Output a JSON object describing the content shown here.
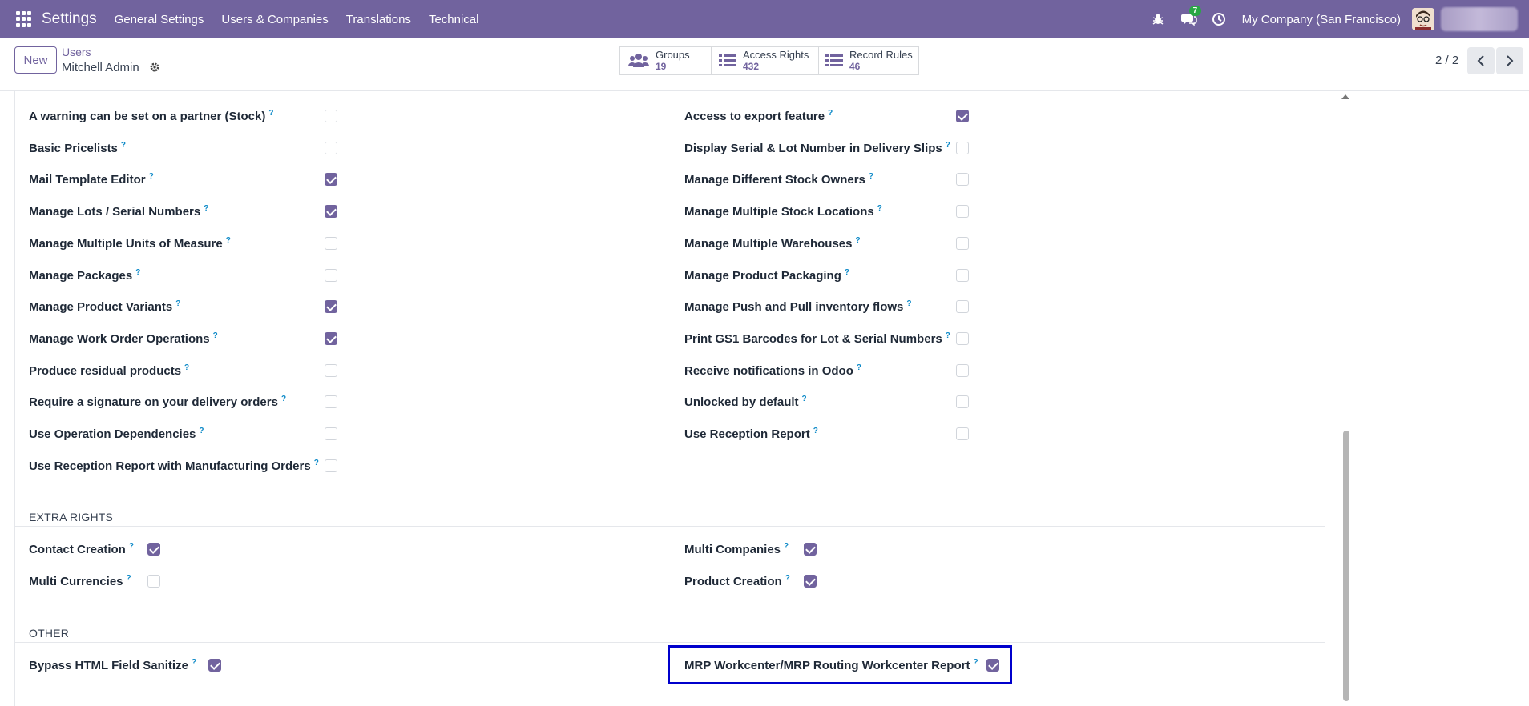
{
  "topbar": {
    "app_name": "Settings",
    "menus": [
      "General Settings",
      "Users & Companies",
      "Translations",
      "Technical"
    ],
    "chat_count": "7",
    "company": "My Company (San Francisco)"
  },
  "control": {
    "new_label": "New",
    "breadcrumb_parent": "Users",
    "breadcrumb_current": "Mitchell Admin",
    "groups_label": "Groups",
    "groups_count": "19",
    "access_label": "Access Rights",
    "access_count": "432",
    "rules_label": "Record Rules",
    "rules_count": "46",
    "pager": "2 / 2"
  },
  "left_rows": [
    {
      "label": "A warning can be set on a partner (Stock)",
      "checked": false
    },
    {
      "label": "Basic Pricelists",
      "checked": false
    },
    {
      "label": "Mail Template Editor",
      "checked": true
    },
    {
      "label": "Manage Lots / Serial Numbers",
      "checked": true
    },
    {
      "label": "Manage Multiple Units of Measure",
      "checked": false
    },
    {
      "label": "Manage Packages",
      "checked": false
    },
    {
      "label": "Manage Product Variants",
      "checked": true
    },
    {
      "label": "Manage Work Order Operations",
      "checked": true
    },
    {
      "label": "Produce residual products",
      "checked": false
    },
    {
      "label": "Require a signature on your delivery orders",
      "checked": false
    },
    {
      "label": "Use Operation Dependencies",
      "checked": false
    },
    {
      "label": "Use Reception Report with Manufacturing Orders",
      "checked": false
    }
  ],
  "right_rows": [
    {
      "label": "Access to export feature",
      "checked": true
    },
    {
      "label": "Display Serial & Lot Number in Delivery Slips",
      "checked": false
    },
    {
      "label": "Manage Different Stock Owners",
      "checked": false
    },
    {
      "label": "Manage Multiple Stock Locations",
      "checked": false
    },
    {
      "label": "Manage Multiple Warehouses",
      "checked": false
    },
    {
      "label": "Manage Product Packaging",
      "checked": false
    },
    {
      "label": "Manage Push and Pull inventory flows",
      "checked": false
    },
    {
      "label": "Print GS1 Barcodes for Lot & Serial Numbers",
      "checked": false
    },
    {
      "label": "Receive notifications in Odoo",
      "checked": false
    },
    {
      "label": "Unlocked by default",
      "checked": false
    },
    {
      "label": "Use Reception Report",
      "checked": false
    }
  ],
  "extra_rights": {
    "title": "EXTRA RIGHTS",
    "rows": [
      {
        "label": "Contact Creation",
        "checked": true
      },
      {
        "label": "Multi Companies",
        "checked": true
      },
      {
        "label": "Multi Currencies",
        "checked": false
      },
      {
        "label": "Product Creation",
        "checked": true
      }
    ]
  },
  "other": {
    "title": "OTHER",
    "rows": [
      {
        "label": "Bypass HTML Field Sanitize",
        "checked": true
      },
      {
        "label": "MRP Workcenter/MRP Routing Workcenter Report",
        "checked": true
      }
    ]
  },
  "help_mark": "?",
  "colors": {
    "brand": "#71639e",
    "highlight": "#0000cc",
    "help": "#0e8ac8"
  }
}
